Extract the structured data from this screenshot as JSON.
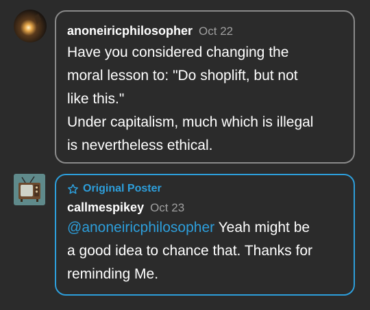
{
  "comments": [
    {
      "username": "anoneiricphilosopher",
      "date": "Oct 22",
      "lines": [
        "Have you considered changing the",
        "moral lesson to: \"Do shoplift, but not",
        "like this.\"",
        "Under capitalism, much which is illegal",
        "is nevertheless ethical."
      ]
    },
    {
      "badge": "Original Poster",
      "username": "callmespikey",
      "date": "Oct 23",
      "mention": "@anoneiricphilosopher",
      "line_1_rest": " Yeah might be",
      "lines": [
        "a good idea to chance that. Thanks for",
        "reminding Me."
      ]
    }
  ],
  "colors": {
    "background": "#2b2b2b",
    "accent": "#2d9fdc",
    "border": "#8a8a8a"
  },
  "icons": [
    "star-outline-icon"
  ]
}
